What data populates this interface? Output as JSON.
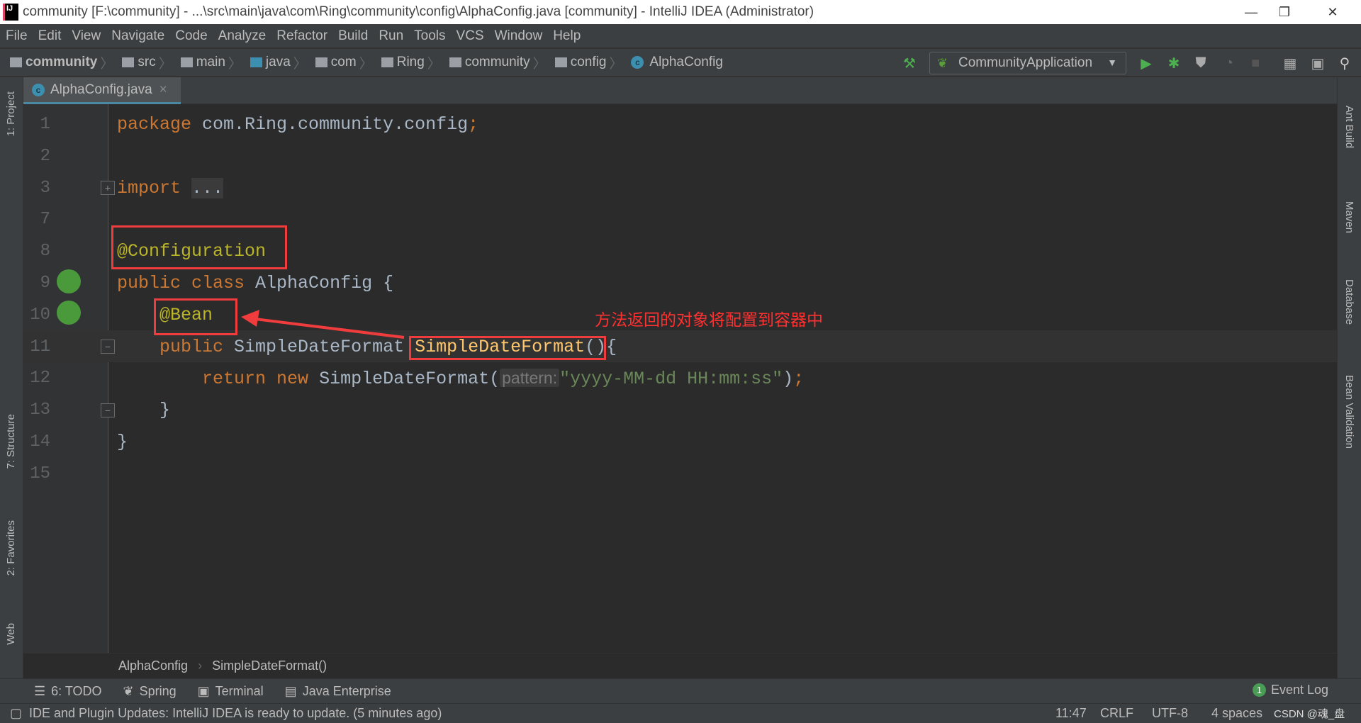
{
  "window": {
    "title": "community [F:\\community] - ...\\src\\main\\java\\com\\Ring\\community\\config\\AlphaConfig.java [community] - IntelliJ IDEA (Administrator)",
    "minimize": "—",
    "restore": "❐",
    "close": "✕",
    "logo": "IJ"
  },
  "menu": [
    "File",
    "Edit",
    "View",
    "Navigate",
    "Code",
    "Analyze",
    "Refactor",
    "Build",
    "Run",
    "Tools",
    "VCS",
    "Window",
    "Help"
  ],
  "nav": {
    "crumbs": [
      "community",
      "src",
      "main",
      "java",
      "com",
      "Ring",
      "community",
      "config",
      "AlphaConfig"
    ],
    "run_config": "CommunityApplication"
  },
  "tabs": [
    {
      "label": "AlphaConfig.java",
      "close": "×"
    }
  ],
  "left_tools": [
    "1: Project",
    "7: Structure",
    "2: Favorites",
    "Web"
  ],
  "right_tools": [
    "Ant Build",
    "Maven",
    "Database",
    "Bean Validation"
  ],
  "editor": {
    "lines": [
      {
        "num": "1",
        "tokens": [
          {
            "t": "package ",
            "c": "kw"
          },
          {
            "t": "com.Ring.community.config",
            "c": ""
          },
          {
            "t": ";",
            "c": "kw"
          }
        ]
      },
      {
        "num": "2",
        "tokens": []
      },
      {
        "num": "3",
        "tokens": [
          {
            "t": "import ",
            "c": "kw"
          },
          {
            "t": "...",
            "c": "fold"
          }
        ]
      },
      {
        "num": "7",
        "tokens": []
      },
      {
        "num": "8",
        "tokens": [
          {
            "t": "@Configuration",
            "c": "an"
          }
        ]
      },
      {
        "num": "9",
        "tokens": [
          {
            "t": "public class ",
            "c": "kw"
          },
          {
            "t": "AlphaConfig {",
            "c": ""
          }
        ]
      },
      {
        "num": "10",
        "tokens": [
          {
            "t": "    ",
            "c": ""
          },
          {
            "t": "@Bean",
            "c": "an"
          }
        ]
      },
      {
        "num": "11",
        "tokens": [
          {
            "t": "    ",
            "c": ""
          },
          {
            "t": "public ",
            "c": "kw"
          },
          {
            "t": "SimpleDateFormat ",
            "c": ""
          },
          {
            "t": "SimpleDateFormat",
            "c": "fn"
          },
          {
            "t": "(){",
            "c": ""
          }
        ]
      },
      {
        "num": "12",
        "tokens": [
          {
            "t": "        ",
            "c": ""
          },
          {
            "t": "return new ",
            "c": "kw"
          },
          {
            "t": "SimpleDateFormat(",
            "c": ""
          },
          {
            "t": "pattern:",
            "c": "hint"
          },
          {
            "t": "\"yyyy-MM-dd HH:mm:ss\"",
            "c": "st"
          },
          {
            "t": ")",
            "c": ""
          },
          {
            "t": ";",
            "c": "kw"
          }
        ]
      },
      {
        "num": "13",
        "tokens": [
          {
            "t": "    }",
            "c": ""
          }
        ]
      },
      {
        "num": "14",
        "tokens": [
          {
            "t": "}",
            "c": ""
          }
        ]
      },
      {
        "num": "15",
        "tokens": []
      }
    ],
    "annotation": "方法返回的对象将配置到容器中",
    "breadcrumb": [
      "AlphaConfig",
      "SimpleDateFormat()"
    ]
  },
  "tool_windows": [
    {
      "icon": "todo-icon",
      "label": "6: TODO"
    },
    {
      "icon": "spring-icon",
      "label": "Spring"
    },
    {
      "icon": "terminal-icon",
      "label": "Terminal"
    },
    {
      "icon": "java-enterprise-icon",
      "label": "Java Enterprise"
    }
  ],
  "event_log": {
    "count": "1",
    "label": "Event Log"
  },
  "status": {
    "message": "IDE and Plugin Updates: IntelliJ IDEA is ready to update. (5 minutes ago)",
    "position": "11:47",
    "line_sep": "CRLF",
    "encoding": "UTF-8",
    "indent": "4 spaces",
    "watermark": "CSDN @魂_盘"
  },
  "colors": {
    "keyword": "#cc7832",
    "annotation": "#bbb529",
    "string": "#6a8759",
    "method": "#ffc66d",
    "highlight": "#f03c3c"
  }
}
